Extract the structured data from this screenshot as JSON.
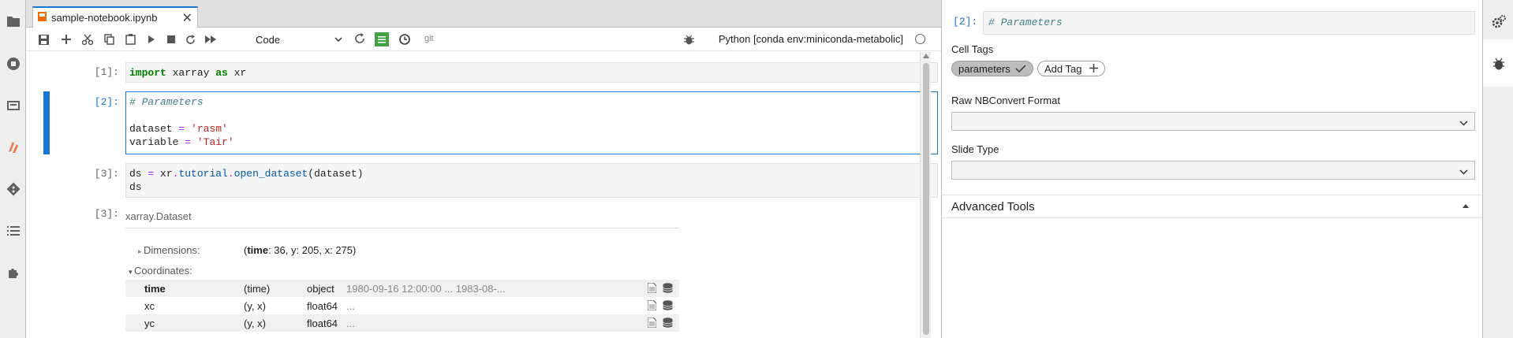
{
  "left_sidebar": {
    "icons": [
      "folder-icon",
      "running-kernels-icon",
      "commands-icon",
      "dask-icon",
      "git-icon",
      "toc-icon",
      "extensions-icon"
    ]
  },
  "tab": {
    "label": "sample-notebook.ipynb",
    "close": "✕"
  },
  "toolbar": {
    "cell_type": "Code",
    "git_label": "git",
    "kernel_name": "Python [conda env:miniconda-metabolic]"
  },
  "cells": {
    "c1": {
      "prompt": "[1]:"
    },
    "c2": {
      "prompt": "[2]:"
    },
    "c3": {
      "prompt": "[3]:"
    },
    "out3": {
      "prompt": "[3]:"
    }
  },
  "output": {
    "header": "xarray.Dataset",
    "dimensions_label": "Dimensions:",
    "dimensions_value_bold": "time",
    "dimensions_value_rest": ": 36, y: 205, x: 275)",
    "dimensions_open": "(",
    "coordinates_label": "Coordinates:",
    "coordinates": [
      {
        "name": "time",
        "dims": "(time)",
        "dtype": "object",
        "preview": "1980-09-16 12:00:00 ... 1983-08-..."
      },
      {
        "name": "xc",
        "dims": "(y, x)",
        "dtype": "float64",
        "preview": "..."
      },
      {
        "name": "yc",
        "dims": "(y, x)",
        "dtype": "float64",
        "preview": "..."
      }
    ]
  },
  "inspector": {
    "prompt": "[2]:",
    "code_preview": "# Parameters",
    "cell_tags_label": "Cell Tags",
    "tags": [
      "parameters"
    ],
    "add_tag_label": "Add Tag",
    "raw_format_label": "Raw NBConvert Format",
    "raw_format_value": "",
    "slide_type_label": "Slide Type",
    "slide_type_value": "",
    "advanced_tools_label": "Advanced Tools"
  },
  "colors": {
    "accent": "#1976d2",
    "keyword": "#008000",
    "comment": "#408080",
    "string": "#ba2121",
    "operator": "#aa22ff"
  }
}
